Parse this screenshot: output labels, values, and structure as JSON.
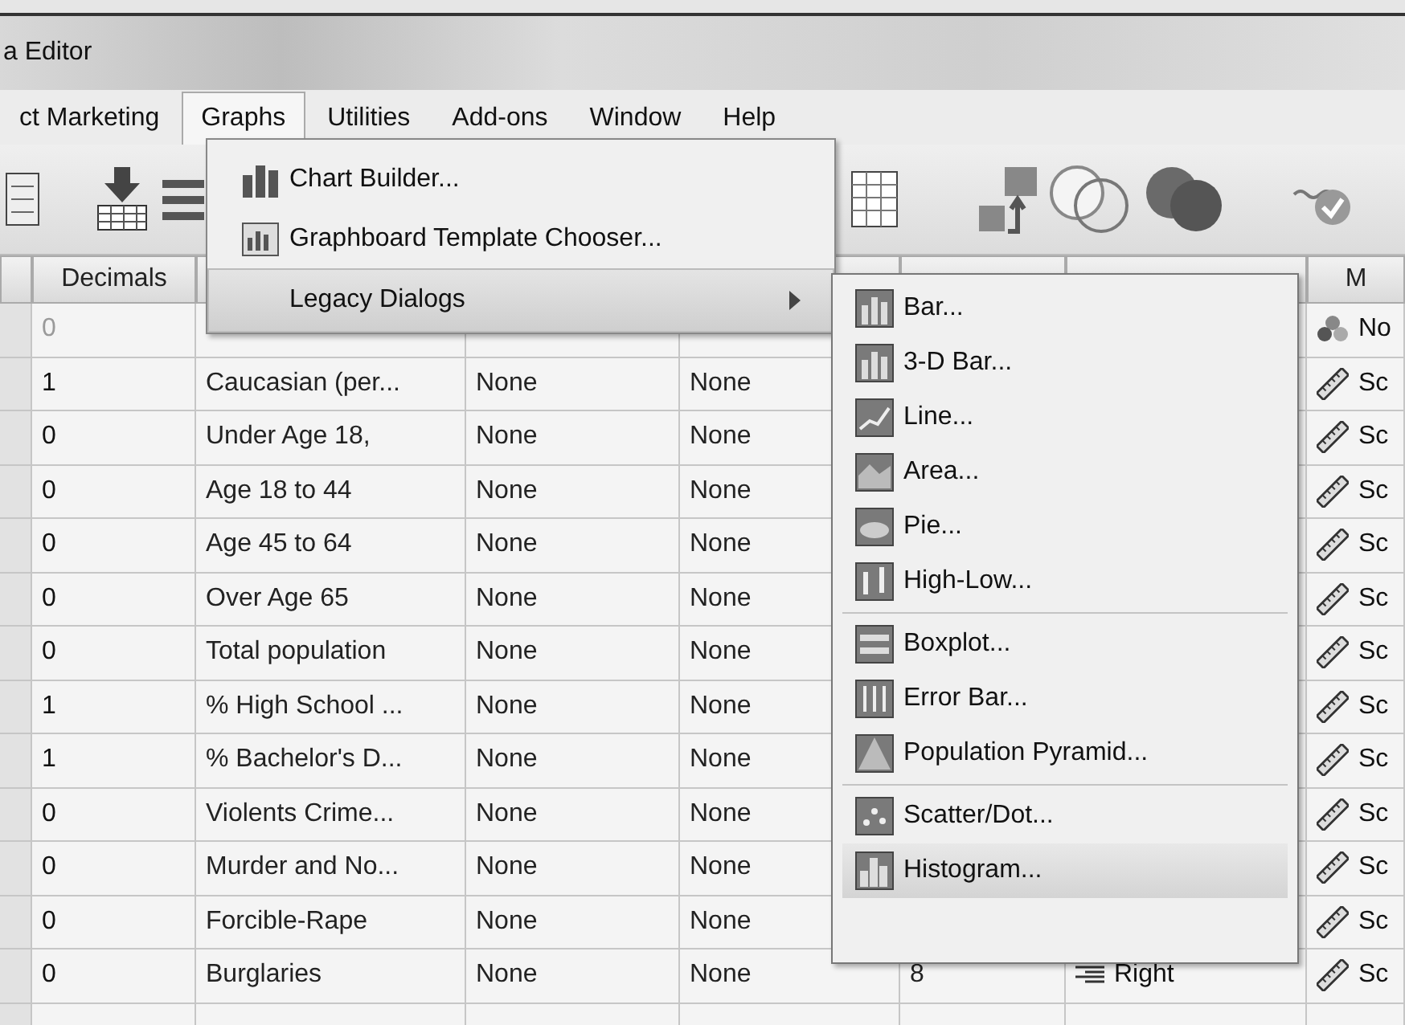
{
  "window": {
    "title": "a Editor"
  },
  "menu_bar": [
    {
      "label": "ct Marketing",
      "selected": false
    },
    {
      "label": "Graphs",
      "selected": true
    },
    {
      "label": "Utilities",
      "selected": false
    },
    {
      "label": "Add-ons",
      "selected": false
    },
    {
      "label": "Window",
      "selected": false
    },
    {
      "label": "Help",
      "selected": false
    }
  ],
  "graphs_menu": [
    {
      "label": "Chart Builder...",
      "kind": "command",
      "selected": false
    },
    {
      "label": "Graphboard Template Chooser...",
      "kind": "command",
      "selected": false
    },
    {
      "label": "Legacy Dialogs",
      "kind": "submenu",
      "selected": true
    }
  ],
  "legacy_submenu": [
    [
      {
        "label": "Bar...",
        "selected": false
      },
      {
        "label": "3-D Bar...",
        "selected": false
      },
      {
        "label": "Line...",
        "selected": false
      },
      {
        "label": "Area...",
        "selected": false
      },
      {
        "label": "Pie...",
        "selected": false
      },
      {
        "label": "High-Low...",
        "selected": false
      }
    ],
    [
      {
        "label": "Boxplot...",
        "selected": false
      },
      {
        "label": "Error Bar...",
        "selected": false
      },
      {
        "label": "Population Pyramid...",
        "selected": false
      }
    ],
    [
      {
        "label": "Scatter/Dot...",
        "selected": false
      },
      {
        "label": "Histogram...",
        "selected": true
      }
    ]
  ],
  "table": {
    "columns": [
      {
        "label": "Decimals"
      },
      {
        "label": "M"
      }
    ],
    "rows": [
      {
        "decimals": "0",
        "dimmed": true,
        "measure": "No",
        "kind": "nominal"
      },
      {
        "decimals": "1",
        "dimmed": false,
        "label": "Caucasian (per...",
        "values": "None",
        "missing": "None",
        "measure": "Sc",
        "kind": "scale"
      },
      {
        "decimals": "0",
        "dimmed": false,
        "label": "Under Age 18,",
        "values": "None",
        "missing": "None",
        "measure": "Sc",
        "kind": "scale"
      },
      {
        "decimals": "0",
        "dimmed": false,
        "label": "Age 18 to 44",
        "values": "None",
        "missing": "None",
        "measure": "Sc",
        "kind": "scale"
      },
      {
        "decimals": "0",
        "dimmed": false,
        "label": "Age 45 to 64",
        "values": "None",
        "missing": "None",
        "measure": "Sc",
        "kind": "scale"
      },
      {
        "decimals": "0",
        "dimmed": false,
        "label": "Over Age 65",
        "values": "None",
        "missing": "None",
        "measure": "Sc",
        "kind": "scale"
      },
      {
        "decimals": "0",
        "dimmed": false,
        "label": "Total population",
        "values": "None",
        "missing": "None",
        "measure": "Sc",
        "kind": "scale"
      },
      {
        "decimals": "1",
        "dimmed": false,
        "label": "% High School ...",
        "values": "None",
        "missing": "None",
        "measure": "Sc",
        "kind": "scale"
      },
      {
        "decimals": "1",
        "dimmed": false,
        "label": "% Bachelor's D...",
        "values": "None",
        "missing": "None",
        "measure": "Sc",
        "kind": "scale"
      },
      {
        "decimals": "0",
        "dimmed": false,
        "label": "Violents Crime...",
        "values": "None",
        "missing": "None",
        "measure": "Sc",
        "kind": "scale"
      },
      {
        "decimals": "0",
        "dimmed": false,
        "label": "Murder and No...",
        "values": "None",
        "missing": "None",
        "measure": "Sc",
        "kind": "scale"
      },
      {
        "decimals": "0",
        "dimmed": false,
        "label": "Forcible-Rape",
        "values": "None",
        "missing": "None",
        "measure": "Sc",
        "kind": "scale"
      },
      {
        "decimals": "0",
        "dimmed": false,
        "label": "Burglaries",
        "values": "None",
        "missing": "None",
        "columns": "8",
        "align": "Right",
        "measure": "Sc",
        "kind": "scale"
      }
    ]
  }
}
